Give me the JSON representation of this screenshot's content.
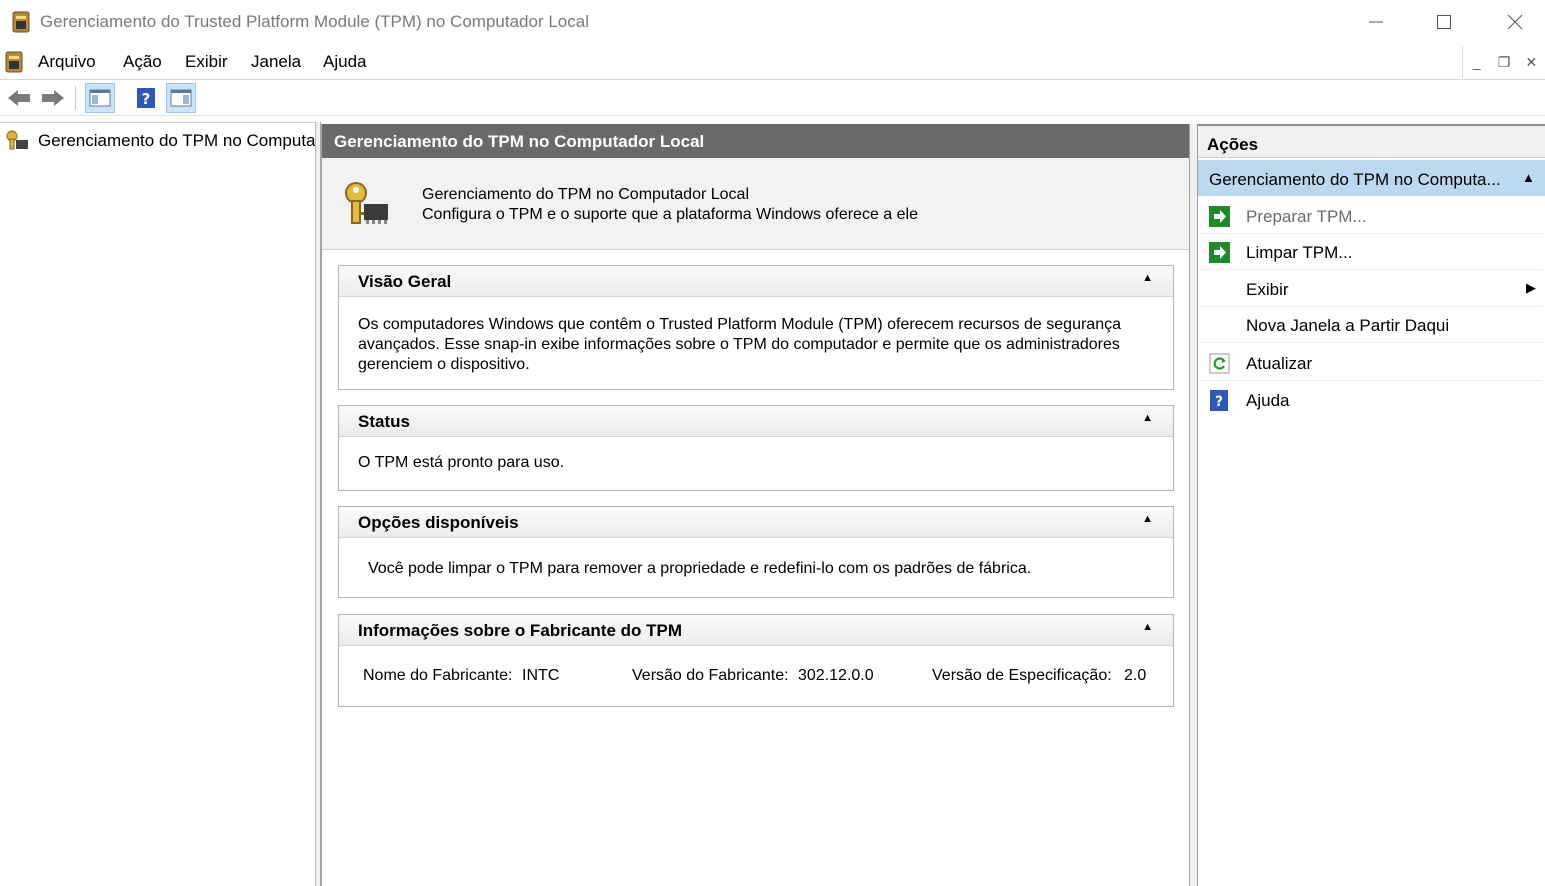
{
  "window": {
    "title": "Gerenciamento do Trusted Platform Module (TPM) no Computador Local"
  },
  "menu": {
    "items": [
      "Arquivo",
      "Ação",
      "Exibir",
      "Janela",
      "Ajuda"
    ]
  },
  "tree": {
    "root_label": "Gerenciamento do TPM no Computador Local"
  },
  "center": {
    "header": "Gerenciamento do TPM no Computador Local",
    "intro_line1": "Gerenciamento do TPM no Computador Local",
    "intro_line2": "Configura o TPM e o suporte que a plataforma Windows oferece a ele",
    "sections": {
      "overview": {
        "title": "Visão Geral",
        "body": "Os computadores Windows que contêm o Trusted Platform Module (TPM) oferecem recursos de segurança avançados. Esse snap-in exibe informações sobre o TPM do computador e permite que os administradores gerenciem o dispositivo."
      },
      "status": {
        "title": "Status",
        "body": "O TPM está pronto para uso."
      },
      "options": {
        "title": "Opções disponíveis",
        "body": "Você pode limpar o TPM para remover a propriedade e redefini-lo com os padrões de fábrica."
      },
      "manufacturer": {
        "title": "Informações sobre o Fabricante do TPM",
        "name_label": "Nome do Fabricante:",
        "name_value": "INTC",
        "version_label": "Versão do Fabricante:",
        "version_value": "302.12.0.0",
        "spec_label": "Versão de Especificação:",
        "spec_value": "2.0"
      }
    }
  },
  "actions": {
    "header": "Ações",
    "group_label": "Gerenciamento do TPM no Computa...",
    "items": [
      {
        "label": "Preparar TPM...",
        "icon": "green-arrow-icon",
        "enabled": false
      },
      {
        "label": "Limpar TPM...",
        "icon": "green-arrow-icon",
        "enabled": true
      },
      {
        "label": "Exibir",
        "icon": "",
        "enabled": true
      },
      {
        "label": "Nova Janela a Partir Daqui",
        "icon": "",
        "enabled": true
      },
      {
        "label": "Atualizar",
        "icon": "refresh-icon",
        "enabled": true
      },
      {
        "label": "Ajuda",
        "icon": "help-icon",
        "enabled": true
      }
    ]
  }
}
